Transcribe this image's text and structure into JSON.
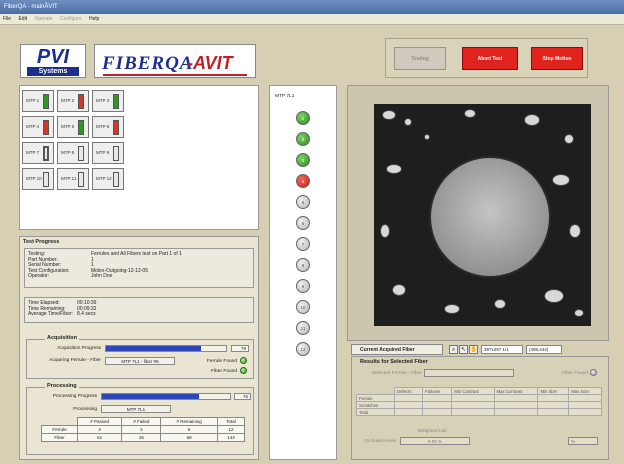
{
  "window": {
    "title": "FiberQA - mainÅVIT"
  },
  "menu": [
    {
      "label": "File",
      "enabled": true
    },
    {
      "label": "Edit",
      "enabled": true
    },
    {
      "label": "Operate",
      "enabled": false
    },
    {
      "label": "Configure",
      "enabled": false
    },
    {
      "label": "Help",
      "enabled": true
    }
  ],
  "logos": {
    "pvi_top": "PVI",
    "pvi_bottom": "Systems",
    "fiberqa": "FIBERQA",
    "avit": "-AVIT"
  },
  "controls": {
    "testing_label": "Testing",
    "abort_label": "Abort Test",
    "stop_label": "Stop Motion"
  },
  "mtp_grid": [
    {
      "label": "MTP 1",
      "status_color": "#2e9a25"
    },
    {
      "label": "MTP 2",
      "status_color": "#d6362a"
    },
    {
      "label": "MTP 3",
      "status_color": "#2e9a25"
    },
    {
      "label": "MTP 4",
      "status_color": "#d6362a"
    },
    {
      "label": "MTP 5",
      "status_color": "#2e9a25"
    },
    {
      "label": "MTP 6",
      "status_color": "#d6362a"
    },
    {
      "label": "MTP 7",
      "status_color": "#e8e8e8"
    },
    {
      "label": "MTP 8",
      "status_color": "#e8e8e8"
    },
    {
      "label": "MTP 9",
      "status_color": "#e8e8e8"
    },
    {
      "label": "MTP 10",
      "status_color": "#e8e8e8"
    },
    {
      "label": "MTP 11",
      "status_color": "#e8e8e8"
    },
    {
      "label": "MTP 12",
      "status_color": "#e8e8e8"
    }
  ],
  "test_progress": {
    "title": "Test Progress",
    "info": [
      {
        "k": "Testing:",
        "v": "Ferrules and All Fibers test on Part 1 of 1"
      },
      {
        "k": "Part Number:",
        "v": "1"
      },
      {
        "k": "Serial Number:",
        "v": "1"
      },
      {
        "k": "Test Configuration:",
        "v": "Molex-Outgoing-12-12-05"
      },
      {
        "k": "Operator:",
        "v": "John Doe"
      }
    ],
    "times": [
      {
        "k": "Time Elapsed:",
        "v": "00:10:39"
      },
      {
        "k": "Time Remaining:",
        "v": "00:09:32"
      },
      {
        "k": "Average Time/Fiber:",
        "v": "8.4 secs"
      }
    ],
    "acquisition": {
      "title": "Acquisition",
      "progress_label": "Acquisition Progress",
      "progress": 79,
      "progress_text": "79",
      "fiber_label": "Acquiring Ferrule - Fiber",
      "fiber_value": "MTP 7L1 - fiber #6",
      "ferrule_found": "Ferrule Found",
      "fiber_found": "Fiber Found"
    },
    "processing": {
      "title": "Processing",
      "progress_label": "Processing Progress",
      "progress": 76,
      "progress_text": "76",
      "processing_label": "Processing",
      "processing_value": "MTP 7L1"
    },
    "stats": {
      "headers": [
        "",
        "# Passed",
        "# Failed",
        "# Remaining",
        "Total"
      ],
      "rows": [
        [
          "Ferrule",
          "3",
          "3",
          "6",
          "12"
        ],
        [
          "Fiber",
          "61",
          "15",
          "68",
          "144"
        ]
      ]
    }
  },
  "fiber_column": {
    "title": "MTP 7L1",
    "fibers": [
      {
        "n": "1",
        "state": "green"
      },
      {
        "n": "2",
        "state": "green"
      },
      {
        "n": "3",
        "state": "green"
      },
      {
        "n": "4",
        "state": "red"
      },
      {
        "n": "5",
        "state": "grey"
      },
      {
        "n": "6",
        "state": "grey"
      },
      {
        "n": "7",
        "state": "grey"
      },
      {
        "n": "8",
        "state": "grey"
      },
      {
        "n": "9",
        "state": "grey"
      },
      {
        "n": "10",
        "state": "grey"
      },
      {
        "n": "11",
        "state": "grey"
      },
      {
        "n": "12",
        "state": "grey"
      }
    ]
  },
  "image_view": {
    "tab_label": "Current Acquired Fiber",
    "zoom_icon": "magnifier-icon",
    "pointer_icon": "pointer-icon",
    "hand_icon": "hand-icon",
    "size_readout": "397x297 1/1",
    "coord_readout": "(408,444)"
  },
  "results": {
    "title": "Results for Selected Fiber",
    "selected_label": "Selected Ferrule - Fiber",
    "fiber_found_label": "Fiber Found",
    "headers": [
      "",
      "Defects",
      "Failures",
      "Min Contrast",
      "Max Contrast",
      "Min Size",
      "Max Size"
    ],
    "rows": [
      "Ferrule",
      "Scratches",
      "Total"
    ],
    "weighted_label": "Weighted List",
    "occluded_label": "Occluded Area",
    "occluded_value": "0.00 %",
    "unit_value": "%"
  }
}
